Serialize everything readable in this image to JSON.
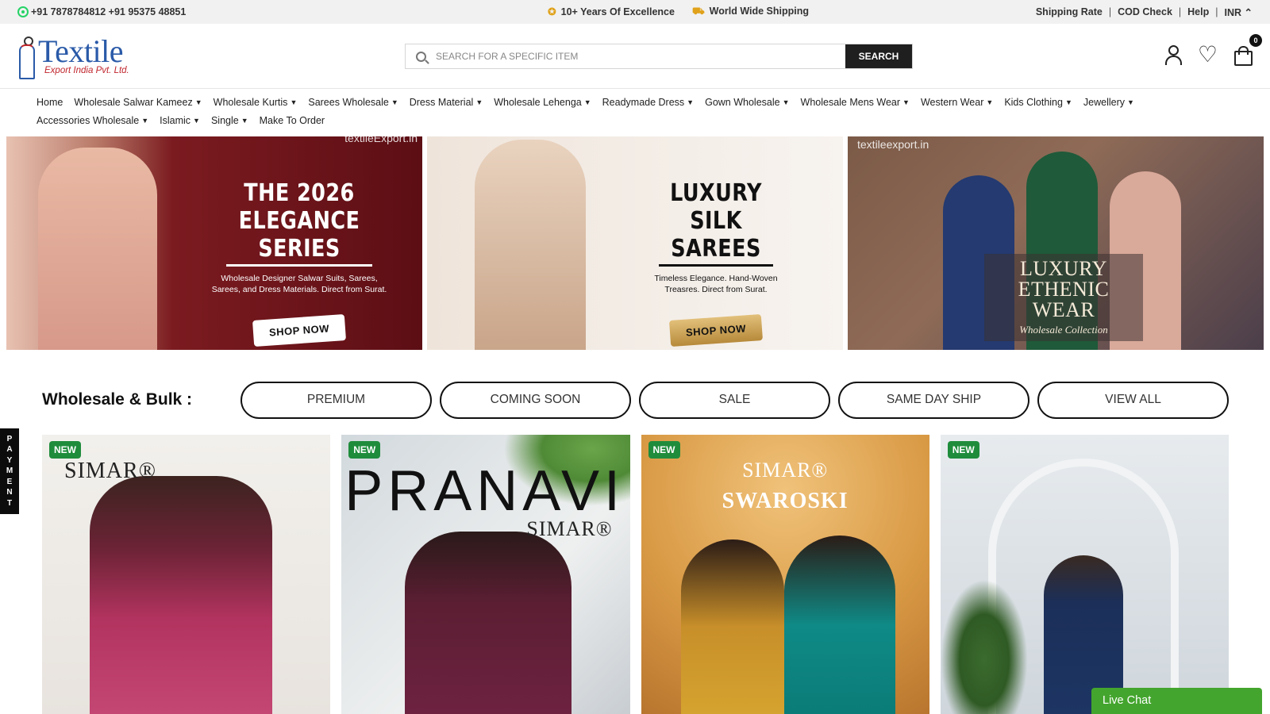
{
  "topbar": {
    "phones": "+91 7878784812 +91 95375 48851",
    "excellence": "10+ Years Of Excellence",
    "shipping": "World Wide Shipping",
    "links": [
      "Shipping Rate",
      "COD Check",
      "Help"
    ],
    "currency": "INR ⌃"
  },
  "logo": {
    "main": "Textile",
    "sub": "Export India Pvt. Ltd."
  },
  "search": {
    "placeholder": "SEARCH FOR A SPECIFIC ITEM",
    "button": "SEARCH"
  },
  "cart": {
    "count": "0"
  },
  "nav": [
    {
      "label": "Home",
      "dropdown": false
    },
    {
      "label": "Wholesale Salwar Kameez",
      "dropdown": true
    },
    {
      "label": "Wholesale Kurtis",
      "dropdown": true
    },
    {
      "label": "Sarees Wholesale",
      "dropdown": true
    },
    {
      "label": "Dress Material",
      "dropdown": true
    },
    {
      "label": "Wholesale Lehenga",
      "dropdown": true
    },
    {
      "label": "Readymade Dress",
      "dropdown": true
    },
    {
      "label": "Gown Wholesale",
      "dropdown": true
    },
    {
      "label": "Wholesale Mens Wear",
      "dropdown": true
    },
    {
      "label": "Western Wear",
      "dropdown": true
    },
    {
      "label": "Kids Clothing",
      "dropdown": true
    },
    {
      "label": "Jewellery",
      "dropdown": true
    },
    {
      "label": "Accessories Wholesale",
      "dropdown": true
    },
    {
      "label": "Islamic",
      "dropdown": true
    },
    {
      "label": "Single",
      "dropdown": true
    },
    {
      "label": "Make To Order",
      "dropdown": false
    }
  ],
  "banners": {
    "b1": {
      "watermark": "textileExport.in",
      "line1": "THE 2026",
      "line2": "ELEGANCE SERIES",
      "sub": "Wholesale Designer Salwar Suits, Sarees, Sarees, and Dress Materials. Direct from Surat.",
      "cta": "SHOP NOW"
    },
    "b2": {
      "line1": "LUXURY",
      "line2": "SILK SAREES",
      "sub": "Timeless Elegance. Hand-Woven Treasres. Direct from Surat.",
      "cta": "SHOP NOW"
    },
    "b3": {
      "watermark": "textileexport.in",
      "line1": "LUXURY",
      "line2": "ETHENIC WEAR",
      "script": "Wholesale Collection"
    }
  },
  "filters": {
    "title": "Wholesale & Bulk :",
    "pills": [
      "PREMIUM",
      "COMING SOON",
      "SALE",
      "SAME DAY SHIP",
      "VIEW ALL"
    ]
  },
  "payment_tab": [
    "P",
    "A",
    "Y",
    "M",
    "E",
    "N",
    "T"
  ],
  "products": [
    {
      "badge": "NEW",
      "brand": "SIMAR®"
    },
    {
      "badge": "NEW",
      "title": "PRANAVI",
      "brand": "SIMAR®"
    },
    {
      "badge": "NEW",
      "brand": "SIMAR®",
      "collection": "SWAROSKI"
    },
    {
      "badge": "NEW"
    }
  ],
  "livechat": "Live Chat",
  "colors": {
    "badge_green": "#1f8c3c",
    "livechat_green": "#44a52e",
    "logo_blue": "#2a5aa8",
    "logo_red": "#c0262d"
  }
}
